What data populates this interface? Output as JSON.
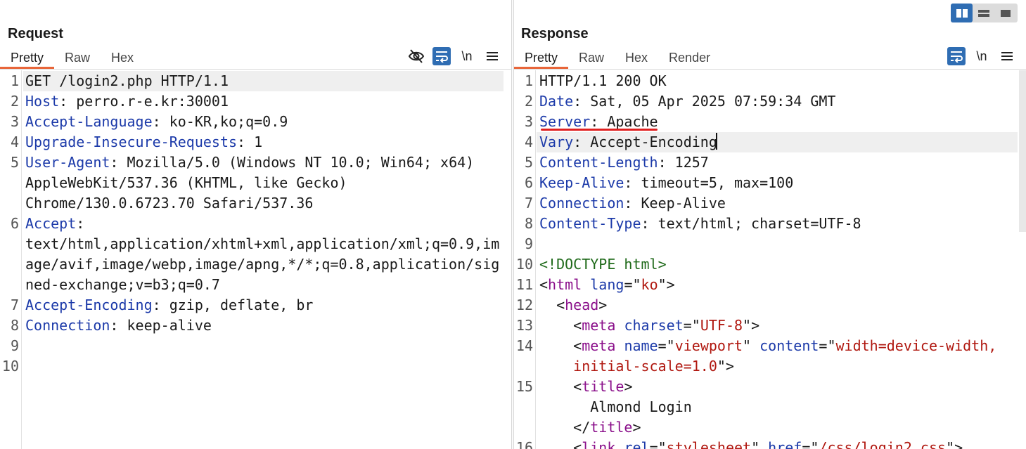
{
  "layout_switch": {
    "modes": [
      "side-by-side-icon",
      "stacked-icon",
      "single-panel-icon"
    ],
    "active": 0
  },
  "request": {
    "title": "Request",
    "tabs": [
      {
        "label": "Pretty",
        "active": true
      },
      {
        "label": "Raw",
        "active": false
      },
      {
        "label": "Hex",
        "active": false
      }
    ],
    "tools": {
      "newline_label": "\\n"
    },
    "lines": [
      {
        "n": "1",
        "name": "",
        "rest": "GET /login2.php HTTP/1.1"
      },
      {
        "n": "2",
        "name": "Host",
        "rest": ": perro.r-e.kr:30001"
      },
      {
        "n": "3",
        "name": "Accept-Language",
        "rest": ": ko-KR,ko;q=0.9"
      },
      {
        "n": "4",
        "name": "Upgrade-Insecure-Requests",
        "rest": ": 1"
      },
      {
        "n": "5",
        "name": "User-Agent",
        "rest": ": Mozilla/5.0 (Windows NT 10.0; Win64; x64)"
      },
      {
        "n": "",
        "name": "",
        "rest": "AppleWebKit/537.36 (KHTML, like Gecko)"
      },
      {
        "n": "",
        "name": "",
        "rest": "Chrome/130.0.6723.70 Safari/537.36"
      },
      {
        "n": "6",
        "name": "Accept",
        "rest": ":"
      },
      {
        "n": "",
        "name": "",
        "rest": "text/html,application/xhtml+xml,application/xml;q=0.9,im"
      },
      {
        "n": "",
        "name": "",
        "rest": "age/avif,image/webp,image/apng,*/*;q=0.8,application/sig"
      },
      {
        "n": "",
        "name": "",
        "rest": "ned-exchange;v=b3;q=0.7"
      },
      {
        "n": "7",
        "name": "Accept-Encoding",
        "rest": ": gzip, deflate, br"
      },
      {
        "n": "8",
        "name": "Connection",
        "rest": ": keep-alive"
      },
      {
        "n": "9",
        "name": "",
        "rest": ""
      },
      {
        "n": "10",
        "name": "",
        "rest": ""
      }
    ]
  },
  "response": {
    "title": "Response",
    "tabs": [
      {
        "label": "Pretty",
        "active": true
      },
      {
        "label": "Raw",
        "active": false
      },
      {
        "label": "Hex",
        "active": false
      },
      {
        "label": "Render",
        "active": false
      }
    ],
    "tools": {
      "newline_label": "\\n"
    },
    "lines": [
      {
        "n": "1",
        "segs": [
          [
            "plain",
            "HTTP/1.1 200 OK"
          ]
        ]
      },
      {
        "n": "2",
        "segs": [
          [
            "hname",
            "Date"
          ],
          [
            "plain",
            ": Sat, 05 Apr 2025 07:59:34 GMT"
          ]
        ]
      },
      {
        "n": "3",
        "segs": [
          [
            "hname",
            "Server"
          ],
          [
            "plain",
            ": Apache"
          ]
        ]
      },
      {
        "n": "4",
        "segs": [
          [
            "hname",
            "Vary"
          ],
          [
            "plain",
            ": Accept-Encoding"
          ]
        ]
      },
      {
        "n": "5",
        "segs": [
          [
            "hname",
            "Content-Length"
          ],
          [
            "plain",
            ": 1257"
          ]
        ]
      },
      {
        "n": "6",
        "segs": [
          [
            "hname",
            "Keep-Alive"
          ],
          [
            "plain",
            ": timeout=5, max=100"
          ]
        ]
      },
      {
        "n": "7",
        "segs": [
          [
            "hname",
            "Connection"
          ],
          [
            "plain",
            ": Keep-Alive"
          ]
        ]
      },
      {
        "n": "8",
        "segs": [
          [
            "hname",
            "Content-Type"
          ],
          [
            "plain",
            ": text/html; charset=UTF-8"
          ]
        ]
      },
      {
        "n": "9",
        "segs": []
      },
      {
        "n": "10",
        "segs": [
          [
            "doctype",
            "<!DOCTYPE html>"
          ]
        ]
      },
      {
        "n": "11",
        "segs": [
          [
            "plain",
            "<"
          ],
          [
            "tag",
            "html"
          ],
          [
            "plain",
            " "
          ],
          [
            "attr",
            "lang"
          ],
          [
            "plain",
            "=\""
          ],
          [
            "str",
            "ko"
          ],
          [
            "plain",
            "\">"
          ]
        ]
      },
      {
        "n": "12",
        "segs": [
          [
            "plain",
            "  <"
          ],
          [
            "tag",
            "head"
          ],
          [
            "plain",
            ">"
          ]
        ]
      },
      {
        "n": "13",
        "segs": [
          [
            "plain",
            "    <"
          ],
          [
            "tag",
            "meta"
          ],
          [
            "plain",
            " "
          ],
          [
            "attr",
            "charset"
          ],
          [
            "plain",
            "=\""
          ],
          [
            "str",
            "UTF-8"
          ],
          [
            "plain",
            "\">"
          ]
        ]
      },
      {
        "n": "14",
        "segs": [
          [
            "plain",
            "    <"
          ],
          [
            "tag",
            "meta"
          ],
          [
            "plain",
            " "
          ],
          [
            "attr",
            "name"
          ],
          [
            "plain",
            "=\""
          ],
          [
            "str",
            "viewport"
          ],
          [
            "plain",
            "\" "
          ],
          [
            "attr",
            "content"
          ],
          [
            "plain",
            "=\""
          ],
          [
            "str",
            "width=device-width,"
          ]
        ]
      },
      {
        "n": "",
        "segs": [
          [
            "str",
            "    initial-scale=1.0"
          ],
          [
            "plain",
            "\">"
          ]
        ]
      },
      {
        "n": "15",
        "segs": [
          [
            "plain",
            "    <"
          ],
          [
            "tag",
            "title"
          ],
          [
            "plain",
            ">"
          ]
        ]
      },
      {
        "n": "",
        "segs": [
          [
            "plain",
            "      Almond Login"
          ]
        ]
      },
      {
        "n": "",
        "segs": [
          [
            "plain",
            "    </"
          ],
          [
            "tag",
            "title"
          ],
          [
            "plain",
            ">"
          ]
        ]
      },
      {
        "n": "16",
        "segs": [
          [
            "plain",
            "    <"
          ],
          [
            "tag",
            "link"
          ],
          [
            "plain",
            " "
          ],
          [
            "attr",
            "rel"
          ],
          [
            "plain",
            "=\""
          ],
          [
            "str",
            "stylesheet"
          ],
          [
            "plain",
            "\" "
          ],
          [
            "attr",
            "href"
          ],
          [
            "plain",
            "=\""
          ],
          [
            "str",
            "/css/login2.css"
          ],
          [
            "plain",
            "\">"
          ]
        ]
      }
    ]
  }
}
